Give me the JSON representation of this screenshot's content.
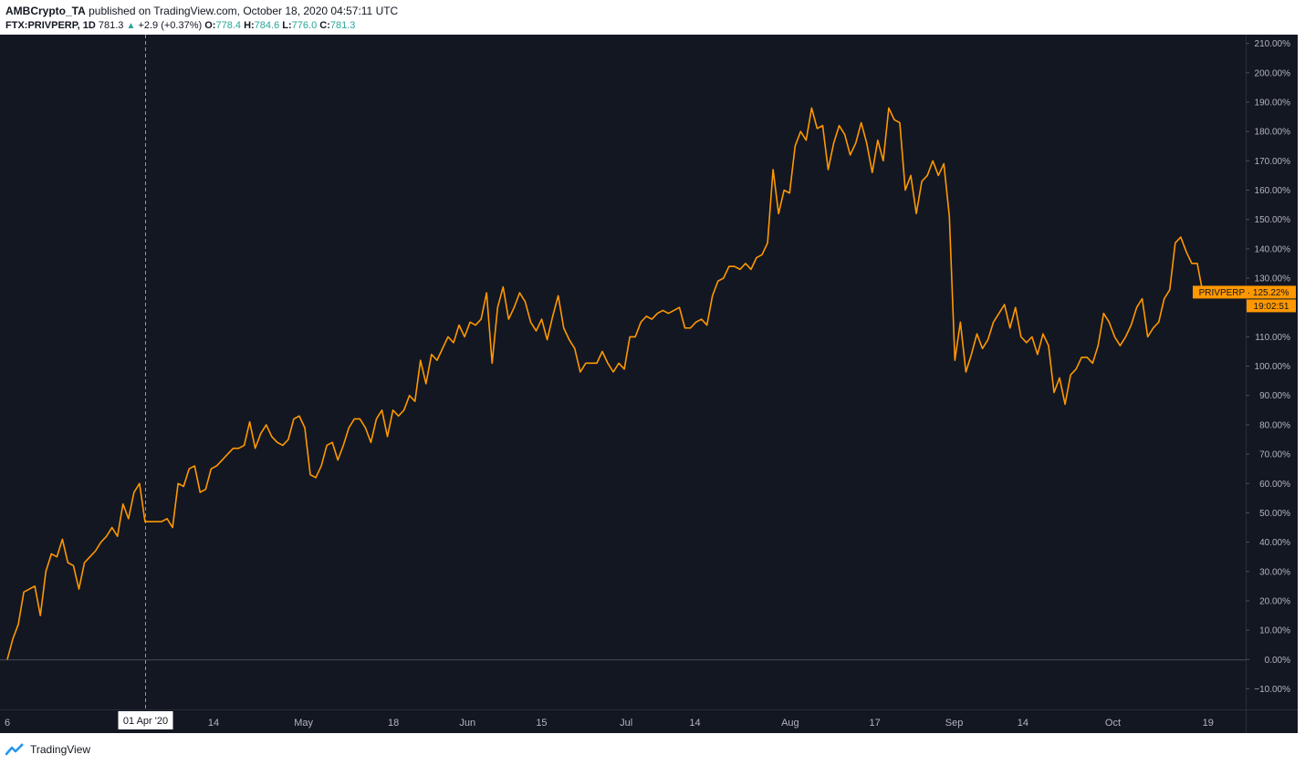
{
  "header": {
    "author": "AMBCrypto_TA",
    "published_text": "published on TradingView.com, October 18, 2020 04:57:11 UTC",
    "symbol_label": "FTX:PRIVPERP, 1D",
    "last_price": "781.3",
    "change": "+2.9 (+0.37%)",
    "open_label": "O:",
    "open_value": "778.4",
    "high_label": "H:",
    "high_value": "784.6",
    "low_label": "L:",
    "low_value": "776.0",
    "close_label": "C:",
    "close_value": "781.3"
  },
  "colors": {
    "background": "#131722",
    "line": "#ff9800",
    "grid": "#2a2e39",
    "text": "#b2b5be",
    "positive": "#26a69a"
  },
  "footer": {
    "brand": "TradingView"
  },
  "chart_data": {
    "type": "line",
    "title": "",
    "series": [
      {
        "name": "PRIVPERP",
        "values": [
          0,
          7,
          12,
          23,
          24,
          25,
          15,
          30,
          36,
          35,
          41,
          33,
          32,
          24,
          33,
          35,
          37,
          40,
          42,
          45,
          42,
          53,
          48,
          57,
          60,
          47,
          47,
          47,
          47,
          48,
          45,
          60,
          59,
          65,
          66,
          57,
          58,
          65,
          66,
          68,
          70,
          72,
          72,
          73,
          81,
          72,
          77,
          80,
          76,
          74,
          73,
          75,
          82,
          83,
          79,
          63,
          62,
          66,
          73,
          74,
          68,
          73,
          79,
          82,
          82,
          79,
          74,
          82,
          85,
          76,
          85,
          83,
          85,
          90,
          88,
          102,
          94,
          104,
          102,
          106,
          110,
          108,
          114,
          110,
          115,
          114,
          116,
          125,
          101,
          120,
          127,
          116,
          120,
          125,
          122,
          115,
          112,
          116,
          109,
          117,
          124,
          113,
          109,
          106,
          98,
          101,
          101,
          101,
          105,
          101,
          98,
          101,
          99,
          110,
          110,
          115,
          117,
          116,
          118,
          119,
          118,
          119,
          120,
          113,
          113,
          115,
          116,
          114,
          124,
          129,
          130,
          134,
          134,
          133,
          135,
          133,
          137,
          138,
          142,
          167,
          152,
          160,
          159,
          175,
          180,
          177,
          188,
          181,
          182,
          167,
          176,
          182,
          179,
          172,
          176,
          183,
          176,
          166,
          177,
          170,
          188,
          184,
          183,
          160,
          165,
          152,
          163,
          165,
          170,
          165,
          169,
          151,
          102,
          115,
          98,
          104,
          111,
          106,
          109,
          115,
          118,
          121,
          113,
          120,
          110,
          108,
          110,
          104,
          111,
          107,
          91,
          96,
          87,
          97,
          99,
          103,
          103,
          101,
          107,
          118,
          115,
          110,
          107,
          110,
          114,
          120,
          123,
          110,
          113,
          115,
          123,
          126,
          142,
          144,
          139,
          135,
          135,
          125
        ]
      }
    ],
    "x_start": "2020-03-06",
    "x_end": "2020-10-18",
    "x_tick_labels": [
      "6",
      "14",
      "May",
      "18",
      "Jun",
      "15",
      "Jul",
      "14",
      "Aug",
      "17",
      "Sep",
      "14",
      "Oct",
      "19"
    ],
    "x_tick_dates": [
      "2020-03-06",
      "2020-04-14",
      "2020-05-01",
      "2020-05-18",
      "2020-06-01",
      "2020-06-15",
      "2020-07-01",
      "2020-07-14",
      "2020-08-01",
      "2020-08-17",
      "2020-09-01",
      "2020-09-14",
      "2020-10-01",
      "2020-10-19"
    ],
    "y_ticks": [
      -10,
      0,
      10,
      20,
      30,
      40,
      50,
      60,
      70,
      80,
      90,
      100,
      110,
      120,
      130,
      140,
      150,
      160,
      170,
      180,
      190,
      200,
      210
    ],
    "y_tick_labels": [
      "−10.00%",
      "0.00%",
      "10.00%",
      "20.00%",
      "30.00%",
      "40.00%",
      "50.00%",
      "60.00%",
      "70.00%",
      "80.00%",
      "90.00%",
      "100.00%",
      "110.00%",
      "120.00%",
      "130.00%",
      "140.00%",
      "150.00%",
      "160.00%",
      "170.00%",
      "180.00%",
      "190.00%",
      "200.00%",
      "210.00%"
    ],
    "y_unit": "%",
    "ylim": [
      -17,
      213
    ],
    "crosshair_date_label": "01 Apr '20",
    "crosshair_date": "2020-04-01",
    "price_label": "PRIVPERP · 125.22%",
    "price_label_value": 125.22,
    "countdown_label": "19:02:51",
    "grid": false,
    "zero_line": true
  }
}
